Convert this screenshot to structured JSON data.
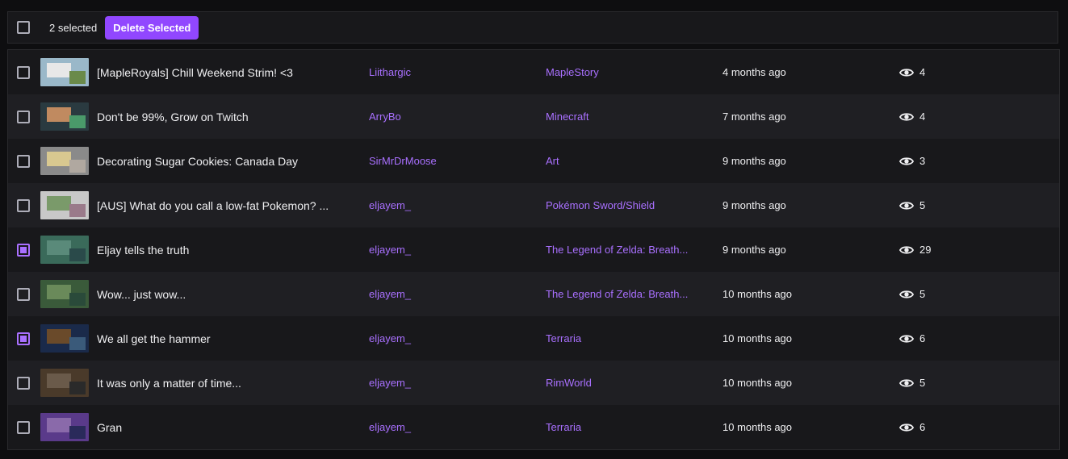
{
  "toolbar": {
    "selected_label": "2 selected",
    "delete_label": "Delete Selected"
  },
  "videos": [
    {
      "title": "[MapleRoyals] Chill Weekend Strim! <3",
      "channel": "Liithargic",
      "game": "MapleStory",
      "date": "4 months ago",
      "views": "4",
      "checked": false,
      "thumb_colors": [
        "#9ab8c9",
        "#e8e8e8",
        "#6a8a4a"
      ]
    },
    {
      "title": "Don't be 99%, Grow on Twitch",
      "channel": "ArryBo",
      "game": "Minecraft",
      "date": "7 months ago",
      "views": "4",
      "checked": false,
      "thumb_colors": [
        "#2a3a40",
        "#c08a60",
        "#4a9a6a"
      ]
    },
    {
      "title": "Decorating Sugar Cookies: Canada Day",
      "channel": "SirMrDrMoose",
      "game": "Art",
      "date": "9 months ago",
      "views": "3",
      "checked": false,
      "thumb_colors": [
        "#8a8a8a",
        "#d8c890",
        "#b0a8a0"
      ]
    },
    {
      "title": "[AUS] What do you call a low-fat Pokemon? ...",
      "channel": "eljayem_",
      "game": "Pokémon Sword/Shield",
      "date": "9 months ago",
      "views": "5",
      "checked": false,
      "thumb_colors": [
        "#c8c8c8",
        "#7a9a6a",
        "#9a7a8a"
      ]
    },
    {
      "title": "Eljay tells the truth",
      "channel": "eljayem_",
      "game": "The Legend of Zelda: Breath...",
      "date": "9 months ago",
      "views": "29",
      "checked": true,
      "thumb_colors": [
        "#3a6a5a",
        "#5a8a7a",
        "#2a4a4a"
      ]
    },
    {
      "title": "Wow... just wow...",
      "channel": "eljayem_",
      "game": "The Legend of Zelda: Breath...",
      "date": "10 months ago",
      "views": "5",
      "checked": false,
      "thumb_colors": [
        "#3a5a3a",
        "#6a8a5a",
        "#2a4a3a"
      ]
    },
    {
      "title": "We all get the hammer",
      "channel": "eljayem_",
      "game": "Terraria",
      "date": "10 months ago",
      "views": "6",
      "checked": true,
      "thumb_colors": [
        "#1a2a4a",
        "#6a4a2a",
        "#3a5a7a"
      ]
    },
    {
      "title": "It was only a matter of time...",
      "channel": "eljayem_",
      "game": "RimWorld",
      "date": "10 months ago",
      "views": "5",
      "checked": false,
      "thumb_colors": [
        "#4a3a2a",
        "#6a5a4a",
        "#2a2a2a"
      ]
    },
    {
      "title": "Gran",
      "channel": "eljayem_",
      "game": "Terraria",
      "date": "10 months ago",
      "views": "6",
      "checked": false,
      "thumb_colors": [
        "#5a3a8a",
        "#8a6aaa",
        "#2a2a5a"
      ]
    }
  ]
}
